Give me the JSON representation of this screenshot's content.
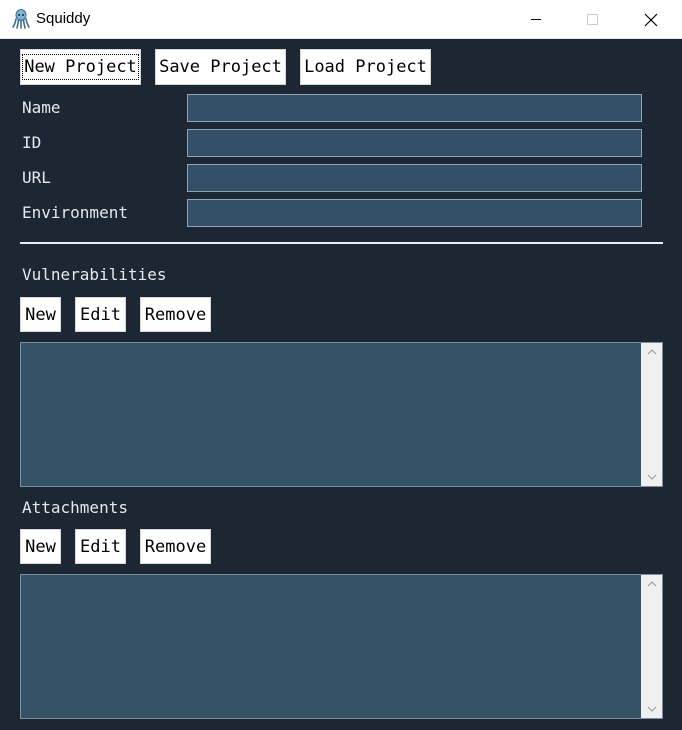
{
  "window": {
    "title": "Squiddy",
    "icon": "squid-icon",
    "controls": [
      "minimize-icon",
      "maximize-icon",
      "close-icon"
    ]
  },
  "colors": {
    "background": "#1c2733",
    "field": "#345066",
    "list": "#355366",
    "text": "#e4e9ee"
  },
  "toolbar": {
    "new_project": "New Project",
    "save_project": "Save Project",
    "load_project": "Load Project"
  },
  "form": {
    "name_label": "Name",
    "name_value": "",
    "id_label": "ID",
    "id_value": "",
    "url_label": "URL",
    "url_value": "",
    "environment_label": "Environment",
    "environment_value": ""
  },
  "vulnerabilities": {
    "heading": "Vulnerabilities",
    "new_label": "New",
    "edit_label": "Edit",
    "remove_label": "Remove",
    "items": []
  },
  "attachments": {
    "heading": "Attachments",
    "new_label": "New",
    "edit_label": "Edit",
    "remove_label": "Remove",
    "items": []
  }
}
